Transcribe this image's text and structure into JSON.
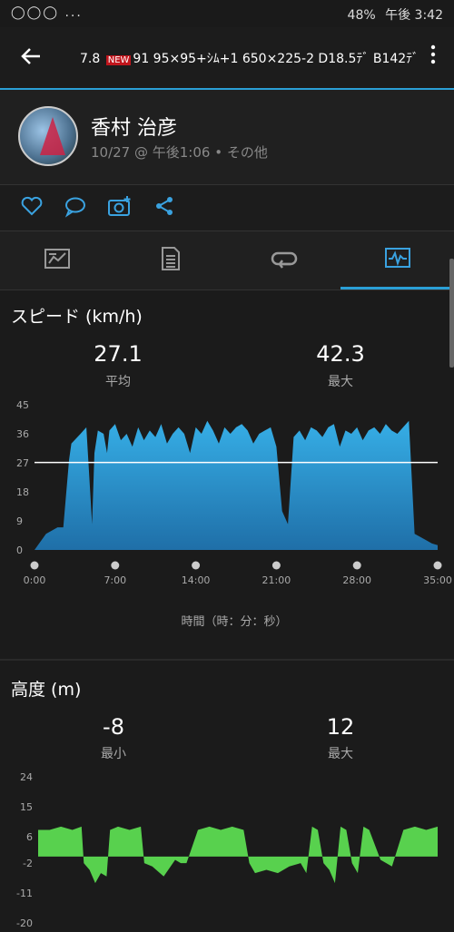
{
  "status": {
    "left_icons": "◯◯◯ ...",
    "battery": "48%",
    "time": "午後 3:42"
  },
  "appbar": {
    "title_pre": "7.8",
    "title_badge": "NEW",
    "title_post": "91 95×95+ｼﾑ+1 650×225-2 D18.5ﾃﾞ B142ﾃﾞ"
  },
  "profile": {
    "name": "香村 治彦",
    "meta": "10/27 @ 午後1:06 • その他"
  },
  "icons": {
    "back": "arrow-left-icon",
    "more": "more-vert-icon",
    "actions": [
      "heart-icon",
      "comment-icon",
      "camera-add-icon",
      "share-icon"
    ],
    "tabs": [
      "summary-icon",
      "details-icon",
      "laps-icon",
      "charts-icon"
    ]
  },
  "speed": {
    "title": "スピード (km/h)",
    "avg_value": "27.1",
    "avg_label": "平均",
    "max_value": "42.3",
    "max_label": "最大",
    "xaxis_label": "時間（時：分：秒）"
  },
  "altitude": {
    "title": "高度 (m)",
    "min_value": "-8",
    "min_label": "最小",
    "max_value": "12",
    "max_label": "最大"
  },
  "colors": {
    "accent": "#2a9fd6",
    "speed_fill": "#2f9ad4",
    "altitude_fill": "#58d14e"
  },
  "chart_data": [
    {
      "type": "area",
      "title": "スピード (km/h)",
      "xlabel": "時間（時：分：秒）",
      "x_ticks": [
        "0:00",
        "7:00",
        "14:00",
        "21:00",
        "28:00",
        "35:00"
      ],
      "y_ticks": [
        "0",
        "9",
        "18",
        "27",
        "36",
        "45"
      ],
      "ylim": [
        0,
        45
      ],
      "xlim_min": [
        0,
        35
      ],
      "average_line": 27.1,
      "series": [
        {
          "x": [
            0,
            1,
            2,
            2.5,
            3,
            3.2,
            4,
            4.5,
            4.8,
            5,
            5.2,
            5.5,
            6,
            6.3,
            6.5,
            7,
            7.5,
            8,
            8.5,
            9,
            9.5,
            10,
            10.5,
            11,
            11.5,
            12,
            12.5,
            13,
            13.5,
            14,
            14.5,
            15,
            15.5,
            16,
            16.5,
            17,
            17.5,
            18,
            18.5,
            19,
            19.5,
            20,
            20.5,
            21,
            21.5,
            22,
            22.5,
            23,
            23.5,
            24,
            24.5,
            25,
            25.5,
            26,
            26.5,
            27,
            27.5,
            28,
            28.5,
            29,
            29.5,
            30,
            30.5,
            31,
            31.5,
            32,
            32.5,
            33,
            33.5,
            34,
            34.5,
            35
          ],
          "y": [
            0,
            5,
            7,
            7,
            28,
            33,
            36,
            38,
            20,
            8,
            30,
            37,
            36,
            30,
            37,
            39,
            34,
            36,
            32,
            38,
            34,
            37,
            35,
            39,
            33,
            36,
            38,
            36,
            30,
            38,
            36,
            40,
            37,
            33,
            38,
            36,
            38,
            39,
            37,
            33,
            36,
            37,
            38,
            32,
            12,
            8,
            35,
            37,
            34,
            38,
            37,
            35,
            38,
            39,
            32,
            37,
            36,
            38,
            34,
            37,
            38,
            36,
            39,
            37,
            36,
            38,
            40,
            5,
            4,
            3,
            2,
            1.5
          ]
        }
      ]
    },
    {
      "type": "area",
      "title": "高度 (m)",
      "y_ticks": [
        "-20",
        "-11",
        "-2",
        "6",
        "15",
        "24"
      ],
      "ylim": [
        -20,
        24
      ],
      "xlim_min": [
        0,
        35
      ],
      "series": [
        {
          "x": [
            0,
            1,
            2,
            3,
            3.8,
            4,
            4.5,
            5,
            5.5,
            6,
            6.3,
            7,
            8,
            9,
            9.3,
            10,
            11,
            12,
            12.5,
            13,
            14,
            15,
            16,
            17,
            18,
            18.5,
            19,
            20,
            21,
            22,
            23,
            23.5,
            24,
            24.5,
            25,
            25.5,
            26,
            26.5,
            27,
            27.5,
            28,
            28.5,
            29,
            30,
            31,
            32,
            33,
            34,
            35
          ],
          "y": [
            8,
            8,
            9,
            8,
            9,
            -2,
            -4,
            -8,
            -5,
            -6,
            8,
            9,
            8,
            9,
            -2,
            -3,
            -6,
            -1,
            -2,
            -2,
            8,
            9,
            8,
            9,
            8,
            -2,
            -5,
            -4,
            -5,
            -3,
            -2,
            -5,
            9,
            8,
            -2,
            -4,
            -8,
            9,
            8,
            -2,
            -5,
            9,
            8,
            -1,
            -3,
            8,
            9,
            8,
            9
          ]
        }
      ]
    }
  ]
}
